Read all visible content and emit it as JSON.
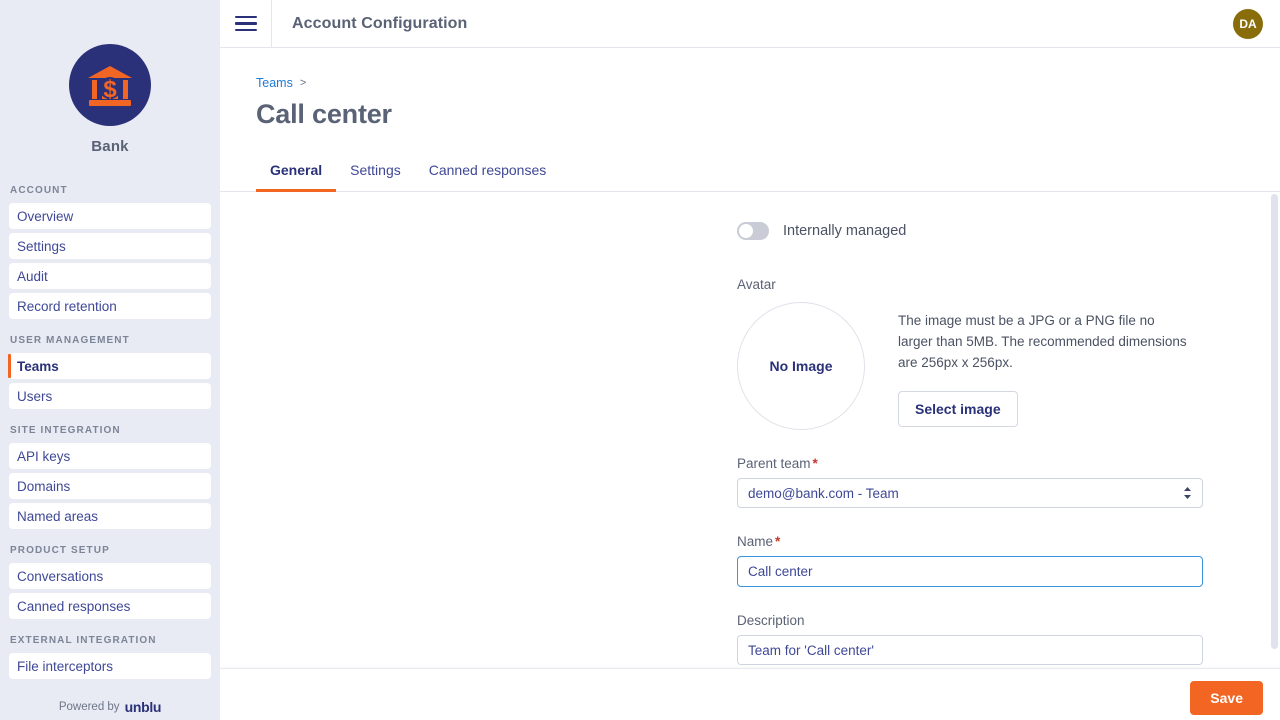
{
  "brand": {
    "name": "Bank",
    "logo_icon": "bank-building-icon",
    "logo_bg": "#2a3179",
    "logo_fg": "#f26522"
  },
  "sidebar": {
    "sections": [
      {
        "label": "ACCOUNT",
        "items": [
          {
            "label": "Overview",
            "active": false
          },
          {
            "label": "Settings",
            "active": false
          },
          {
            "label": "Audit",
            "active": false
          },
          {
            "label": "Record retention",
            "active": false
          }
        ]
      },
      {
        "label": "USER MANAGEMENT",
        "items": [
          {
            "label": "Teams",
            "active": true
          },
          {
            "label": "Users",
            "active": false
          }
        ]
      },
      {
        "label": "SITE INTEGRATION",
        "items": [
          {
            "label": "API keys",
            "active": false
          },
          {
            "label": "Domains",
            "active": false
          },
          {
            "label": "Named areas",
            "active": false
          }
        ]
      },
      {
        "label": "PRODUCT SETUP",
        "items": [
          {
            "label": "Conversations",
            "active": false
          },
          {
            "label": "Canned responses",
            "active": false
          }
        ]
      },
      {
        "label": "EXTERNAL INTEGRATION",
        "items": [
          {
            "label": "File interceptors",
            "active": false
          }
        ]
      }
    ],
    "footer": {
      "powered_by": "Powered by",
      "vendor": "unblu"
    }
  },
  "topbar": {
    "menu_icon": "hamburger-icon",
    "title": "Account Configuration",
    "avatar_initials": "DA"
  },
  "page": {
    "breadcrumb": {
      "parent": "Teams",
      "separator": ">"
    },
    "title": "Call center",
    "tabs": [
      {
        "label": "General",
        "active": true
      },
      {
        "label": "Settings",
        "active": false
      },
      {
        "label": "Canned responses",
        "active": false
      }
    ]
  },
  "form": {
    "internally_managed": {
      "label": "Internally managed",
      "value": "off"
    },
    "avatar": {
      "label": "Avatar",
      "placeholder_text": "No Image",
      "help": "The image must be a JPG or a PNG file no larger than 5MB. The recommended dimensions are 256px x 256px.",
      "select_button": "Select image"
    },
    "parent_team": {
      "label": "Parent team",
      "required": "*",
      "value": "demo@bank.com - Team"
    },
    "name": {
      "label": "Name",
      "required": "*",
      "value": "Call center",
      "placeholder": "Name"
    },
    "description": {
      "label": "Description",
      "value": "Team for 'Call center'",
      "placeholder": "Description"
    }
  },
  "footer": {
    "save_label": "Save",
    "accent": "#f26522"
  }
}
